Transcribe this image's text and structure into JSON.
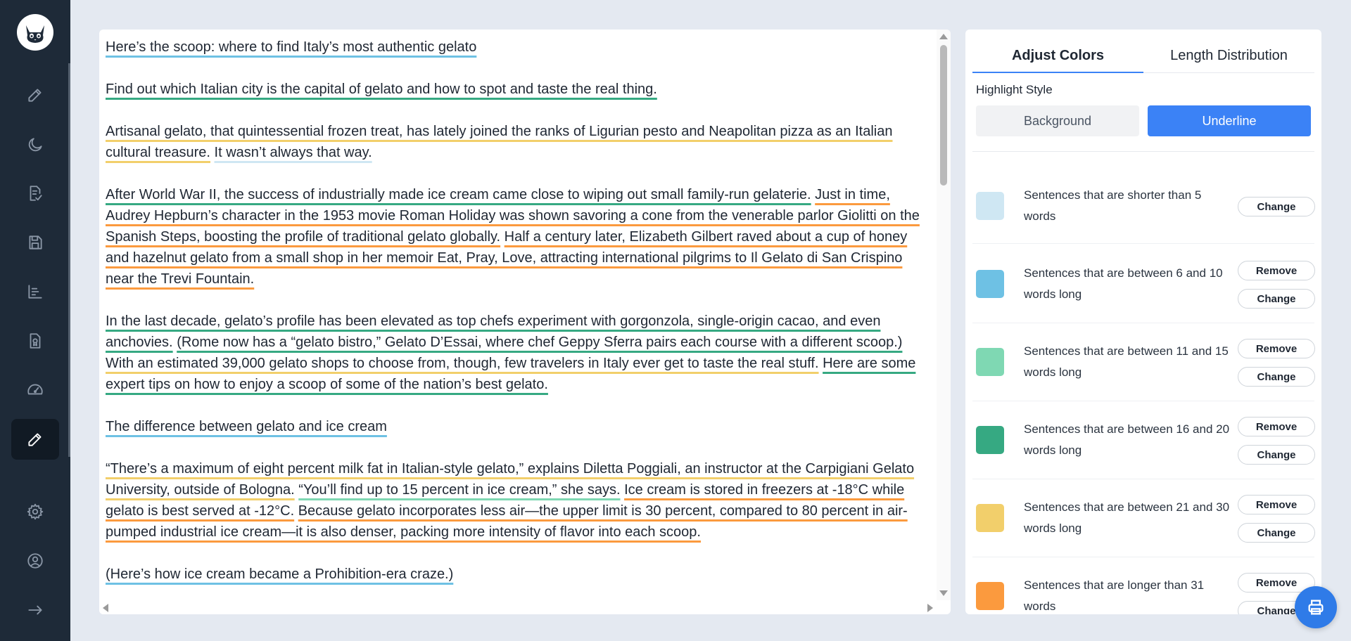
{
  "sidebar": {
    "logo_icon": "cat-logo-icon",
    "items": [
      {
        "icon": "pencil-icon",
        "active": false
      },
      {
        "icon": "moon-icon",
        "active": false
      },
      {
        "icon": "checklist-document-icon",
        "active": false
      },
      {
        "icon": "save-icon",
        "active": false
      },
      {
        "icon": "bar-chart-icon",
        "active": false
      },
      {
        "icon": "document-award-icon",
        "active": false
      },
      {
        "icon": "gauge-icon",
        "active": false
      },
      {
        "icon": "highlighter-icon",
        "active": true
      },
      {
        "icon": "gear-icon",
        "active": false
      },
      {
        "icon": "user-circle-icon",
        "active": false
      },
      {
        "icon": "arrow-right-icon",
        "active": false
      }
    ]
  },
  "editor": {
    "paragraphs": [
      [
        {
          "text": "Here’s the scoop: where to find Italy’s most authentic gelato",
          "c": 2
        }
      ],
      [
        {
          "text": "Find out which Italian city is the capital of gelato and how to spot and taste the real thing.",
          "c": 4
        }
      ],
      [
        {
          "text": "Artisanal gelato, that quintessential frozen treat, has lately joined the ranks of Ligurian pesto and Neapolitan pizza as an Italian cultural treasure.",
          "c": 5
        },
        {
          "text": "It wasn’t always that way.",
          "c": 1
        }
      ],
      [
        {
          "text": "After World War II, the success of industrially made ice cream came close to wiping out small family-run gelaterie.",
          "c": 4
        },
        {
          "text": "Just in time, Audrey Hepburn’s character in the 1953 movie Roman Holiday was shown savoring a cone from the venerable parlor Giolitti on the Spanish Steps, boosting the profile of traditional gelato globally.",
          "c": 6
        },
        {
          "text": "Half a century later, Elizabeth Gilbert raved about a cup of honey and hazelnut gelato from a small shop in her memoir Eat, Pray, Love, attracting international pilgrims to Il Gelato di San Crispino near the Trevi Fountain.",
          "c": 6
        }
      ],
      [
        {
          "text": "In the last decade, gelato’s profile has been elevated as top chefs experiment with gorgonzola, single-origin cacao, and even anchovies.",
          "c": 4
        },
        {
          "text": "(Rome now has a “gelato bistro,” Gelato D’Essai, where chef Geppy Sferra pairs each course with a different scoop.)",
          "c": 4
        },
        {
          "text": "With an estimated 39,000 gelato shops to choose from, though, few travelers in Italy ever get to taste the real stuff.",
          "c": 5
        },
        {
          "text": "Here are some expert tips on how to enjoy a scoop of some of the nation’s best gelato.",
          "c": 4
        }
      ],
      [
        {
          "text": "The difference between gelato and ice cream",
          "c": 2
        }
      ],
      [
        {
          "text": "“There’s a maximum of eight percent milk fat in Italian-style gelato,” explains Diletta Poggiali, an instructor at the Carpigiani Gelato University, outside of Bologna.",
          "c": 5
        },
        {
          "text": "“You’ll find up to 15 percent in ice cream,” she says.",
          "c": 3
        },
        {
          "text": "Ice cream is stored in freezers at -18°C while gelato is best served at -12°C.",
          "c": 6
        },
        {
          "text": "Because gelato incorporates less air—the upper limit is 30 percent, compared to 80 percent in air-pumped industrial ice cream—it is also denser, packing more intensity of flavor into each scoop.",
          "c": 6
        }
      ],
      [
        {
          "text": "(Here’s how ice cream became a Prohibition-era craze.)",
          "c": 2
        }
      ]
    ]
  },
  "panel": {
    "tabs": [
      "Adjust Colors",
      "Length Distribution"
    ],
    "active_tab": "Adjust Colors",
    "highlight_style_label": "Highlight Style",
    "style_options": [
      "Background",
      "Underline"
    ],
    "selected_style": "Underline",
    "rules": [
      {
        "label": "Sentences that are shorter than 5 words",
        "color": "#cfe7f3",
        "buttons": [
          "Change"
        ]
      },
      {
        "label": "Sentences that are between 6 and 10 words long",
        "color": "#6ec1e4",
        "buttons": [
          "Remove",
          "Change"
        ]
      },
      {
        "label": "Sentences that are between 11 and 15 words long",
        "color": "#7fd8b3",
        "buttons": [
          "Remove",
          "Change"
        ]
      },
      {
        "label": "Sentences that are between 16 and 20 words long",
        "color": "#36a982",
        "buttons": [
          "Remove",
          "Change"
        ]
      },
      {
        "label": "Sentences that are between 21 and 30 words long",
        "color": "#f2cf6b",
        "buttons": [
          "Remove",
          "Change"
        ]
      },
      {
        "label": "Sentences that are longer than 31 words",
        "color": "#fb9a3e",
        "buttons": [
          "Remove",
          "Change"
        ]
      }
    ]
  },
  "fab": {
    "icon": "print-icon"
  }
}
